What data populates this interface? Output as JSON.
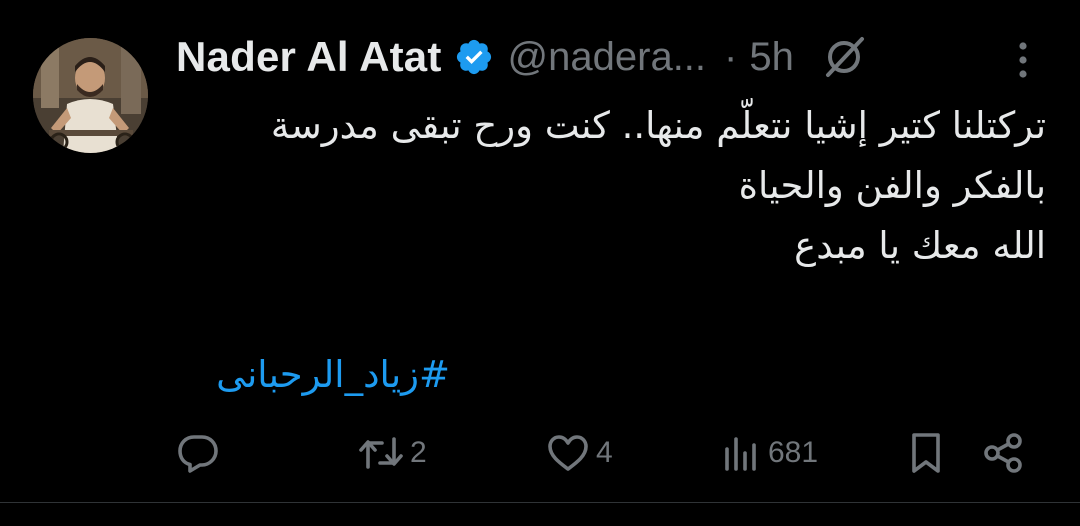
{
  "tweet": {
    "author": {
      "name": "Nader Al Atat",
      "handle": "@nadera...",
      "verified": true,
      "avatar": "avatar-photo"
    },
    "time_separator": "·",
    "timestamp": "5h",
    "body_lines": [
      "تركتلنا كتير إشيا نتعلّم منها.. كنت ورح تبقى مدرسة",
      "بالفكر والفن والحياة",
      "الله معك يا مبدع"
    ],
    "hashtag": "#زياد_الرحبانى",
    "actions": {
      "reply": {
        "icon": "reply-icon",
        "count": ""
      },
      "retweet": {
        "icon": "retweet-icon",
        "count": "2"
      },
      "like": {
        "icon": "heart-icon",
        "count": "4"
      },
      "views": {
        "icon": "views-icon",
        "count": "681"
      },
      "bookmark": {
        "icon": "bookmark-icon"
      },
      "share": {
        "icon": "share-icon"
      }
    }
  },
  "colors": {
    "background": "#000000",
    "text": "#e7e9ea",
    "muted": "#71767b",
    "accent": "#1d9bf0"
  }
}
